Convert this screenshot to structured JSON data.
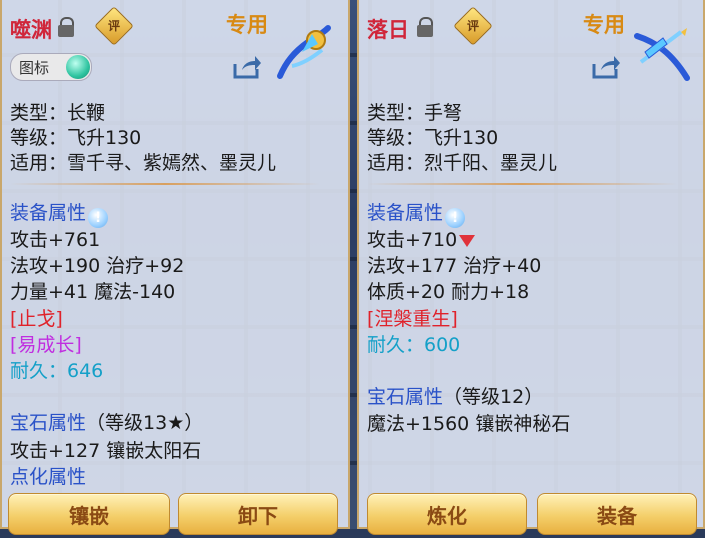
{
  "left": {
    "name": "噬渊",
    "rate_label": "评",
    "exclusive_label": "专用",
    "toggle_label": "图标",
    "type": "类型：长鞭",
    "level": "等级：飞升130",
    "usable": "适用：雪千寻、紫嫣然、墨灵儿",
    "equip_attr_title": "装备属性",
    "stats": [
      "攻击+761",
      "法攻+190 治疗+92",
      "力量+41 魔法-140"
    ],
    "special_skill": "[止戈]",
    "special_effect": "[易成长]",
    "durability": "耐久：646",
    "gem_attr_title": "宝石属性",
    "gem_level": "（等级13★）",
    "gem_stat": "攻击+127 镶嵌太阳石",
    "refine_title": "点化属性",
    "btn_inlay": "镶嵌",
    "btn_unequip": "卸下"
  },
  "right": {
    "name": "落日",
    "rate_label": "评",
    "exclusive_label": "专用",
    "type": "类型：手弩",
    "level": "等级：飞升130",
    "usable": "适用：烈千阳、墨灵儿",
    "equip_attr_title": "装备属性",
    "stats": [
      "攻击+710",
      "法攻+177 治疗+40",
      "体质+20 耐力+18"
    ],
    "special_skill": "[涅槃重生]",
    "durability": "耐久：600",
    "gem_attr_title": "宝石属性",
    "gem_level": "（等级12）",
    "gem_stat": "魔法+1560 镶嵌神秘石",
    "btn_refine": "炼化",
    "btn_equip": "装备"
  },
  "colors": {
    "title": "#d0263a",
    "attr_heading": "#2a52c8",
    "skill": "#e0222a",
    "effect": "#c02ee0",
    "durability": "#14a0c8",
    "button": "#f4cf6a"
  }
}
